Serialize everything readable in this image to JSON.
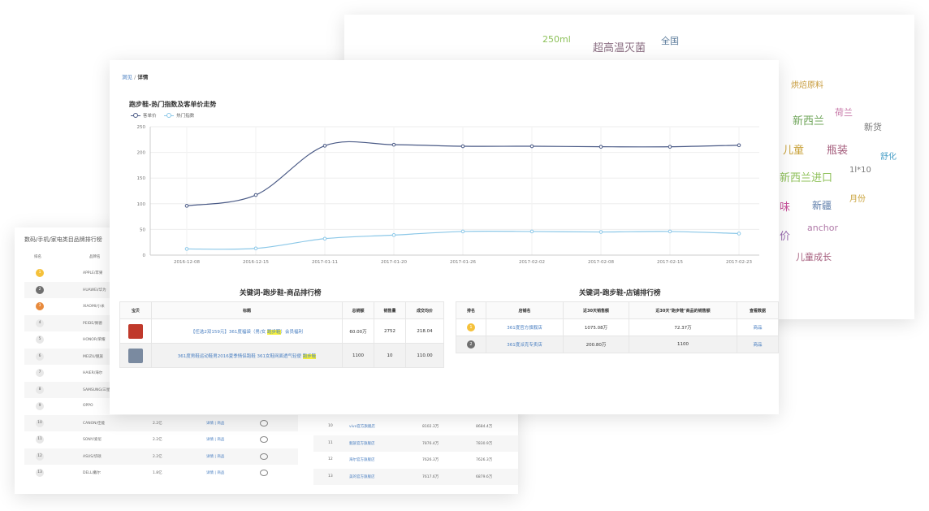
{
  "word_cloud": [
    {
      "text": "250ml",
      "color": "#8dc15a",
      "size": 11
    },
    {
      "text": "超高温灭菌",
      "color": "#8a6e82",
      "size": 13
    },
    {
      "text": "全国",
      "color": "#5a7a9a",
      "size": 11
    },
    {
      "text": "烘焙原料",
      "color": "#c79a3a",
      "size": 10
    },
    {
      "text": "荷兰",
      "color": "#c778a8",
      "size": 11
    },
    {
      "text": "新西兰",
      "color": "#6fa55a",
      "size": 13
    },
    {
      "text": "新货",
      "color": "#7a7a7a",
      "size": 11
    },
    {
      "text": "儿童",
      "color": "#c9a23a",
      "size": 13
    },
    {
      "text": "瓶装",
      "color": "#a35a7a",
      "size": 13
    },
    {
      "text": "舒化",
      "color": "#4aa0c8",
      "size": 10
    },
    {
      "text": "新西兰进口",
      "color": "#8fc15a",
      "size": 13
    },
    {
      "text": "1l*10",
      "color": "#7a7a7a",
      "size": 10
    },
    {
      "text": "味",
      "color": "#c9509a",
      "size": 13
    },
    {
      "text": "新疆",
      "color": "#5a7aa8",
      "size": 12
    },
    {
      "text": "月份",
      "color": "#c9a23a",
      "size": 10
    },
    {
      "text": "anchor",
      "color": "#b07aa8",
      "size": 11
    },
    {
      "text": "价",
      "color": "#9a6ab0",
      "size": 13
    },
    {
      "text": "儿童成长",
      "color": "#a35a7a",
      "size": 11
    }
  ],
  "brand_panel": {
    "title": "数码/手机/家电类目品牌排行榜",
    "headers": [
      "排名",
      "品牌名"
    ],
    "rows": [
      {
        "rank": "1",
        "name": "APPLE/苹果"
      },
      {
        "rank": "2",
        "name": "HUAWEI/华为"
      },
      {
        "rank": "3",
        "name": "XIAOMI/小米"
      },
      {
        "rank": "4",
        "name": "PEIDE/佩德"
      },
      {
        "rank": "5",
        "name": "HONOR/荣耀"
      },
      {
        "rank": "6",
        "name": "MEIZU/魅族"
      },
      {
        "rank": "7",
        "name": "HAIER/海尔"
      },
      {
        "rank": "8",
        "name": "SAMSUNG/三星"
      },
      {
        "rank": "9",
        "name": "OPPO"
      },
      {
        "rank": "10",
        "name": "CANON/佳能",
        "amount": "2.2亿",
        "links": "详情 | 商品"
      },
      {
        "rank": "11",
        "name": "SONY/索尼",
        "amount": "2.2亿",
        "links": "详情 | 商品"
      },
      {
        "rank": "12",
        "name": "ASUS/华硕",
        "amount": "2.2亿",
        "links": "详情 | 商品"
      },
      {
        "rank": "13",
        "name": "DELL/戴尔",
        "amount": "1.8亿",
        "links": "详情 | 商品"
      }
    ],
    "store_rows": [
      {
        "rank": "10",
        "name": "vivo官方旗舰店",
        "a": "8102.3万",
        "b": "8684.4万"
      },
      {
        "rank": "11",
        "name": "魅族官方旗舰店",
        "a": "7876.4万",
        "b": "7830.9万"
      },
      {
        "rank": "12",
        "name": "海尔官方旗舰店",
        "a": "7626.3万",
        "b": "7626.3万"
      },
      {
        "rank": "13",
        "name": "美的官方旗舰店",
        "a": "7617.6万",
        "b": "6879.6万"
      }
    ]
  },
  "breadcrumb": {
    "link": "洞见",
    "sep": "/",
    "current": "详情"
  },
  "chart_title": "跑步鞋-热门指数及客单价走势",
  "chart_data": {
    "type": "line",
    "x": [
      "2016-12-08",
      "2016-12-15",
      "2017-01-11",
      "2017-01-20",
      "2017-01-26",
      "2017-02-02",
      "2017-02-08",
      "2017-02-15",
      "2017-02-23"
    ],
    "series": [
      {
        "name": "客单价",
        "color": "#4a5a86",
        "values": [
          96,
          117,
          213,
          215,
          212,
          212,
          211,
          211,
          214
        ]
      },
      {
        "name": "热门指数",
        "color": "#8cc8e8",
        "values": [
          12,
          13,
          32,
          39,
          46,
          46,
          45,
          46,
          42
        ]
      }
    ],
    "yticks": [
      0,
      50,
      100,
      150,
      200,
      250
    ],
    "ylim": [
      0,
      250
    ],
    "grid": true,
    "legend_position": "top-left"
  },
  "products": {
    "title": "关键词-跑步鞋-商品排行榜",
    "headers": [
      "宝贝",
      "标题",
      "总销额",
      "销售量",
      "成交均价"
    ],
    "rows": [
      {
        "pre": "【任选2双159元】361度福袋（男/女 ",
        "kw": "跑步鞋",
        "post": "）会员福利",
        "sales": "60.00万",
        "qty": "2752",
        "avg": "218.04",
        "thumb": "#c0392b"
      },
      {
        "pre": "361度男鞋运动鞋男2016夏季情侣跑鞋 361女鞋网面透气轻便 ",
        "kw": "跑步鞋",
        "post": "",
        "sales": "1100",
        "qty": "10",
        "avg": "110.00",
        "thumb": "#7a8aa0"
      }
    ]
  },
  "stores": {
    "title": "关键词-跑步鞋-店铺排行榜",
    "headers": [
      "排名",
      "店铺名",
      "近30天销售额",
      "近30天\"跑步鞋\"商品的销售额",
      "查看数据"
    ],
    "rows": [
      {
        "rank": "1",
        "name": "361度官方旗舰店",
        "sales": "1075.08万",
        "kw_sales": "72.37万",
        "action": "商品",
        "badge": "#f5c13a"
      },
      {
        "rank": "2",
        "name": "361度派克专卖店",
        "sales": "200.80万",
        "kw_sales": "1100",
        "action": "商品",
        "badge": "#6f6f6f"
      }
    ]
  }
}
